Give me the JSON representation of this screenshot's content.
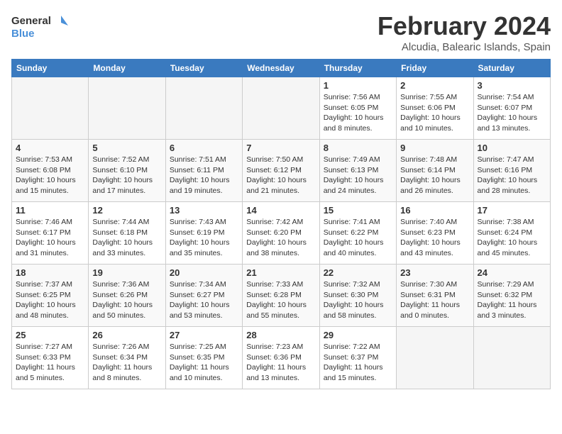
{
  "header": {
    "logo_general": "General",
    "logo_blue": "Blue",
    "month_title": "February 2024",
    "location": "Alcudia, Balearic Islands, Spain"
  },
  "days_of_week": [
    "Sunday",
    "Monday",
    "Tuesday",
    "Wednesday",
    "Thursday",
    "Friday",
    "Saturday"
  ],
  "weeks": [
    [
      {
        "day": "",
        "info": ""
      },
      {
        "day": "",
        "info": ""
      },
      {
        "day": "",
        "info": ""
      },
      {
        "day": "",
        "info": ""
      },
      {
        "day": "1",
        "info": "Sunrise: 7:56 AM\nSunset: 6:05 PM\nDaylight: 10 hours\nand 8 minutes."
      },
      {
        "day": "2",
        "info": "Sunrise: 7:55 AM\nSunset: 6:06 PM\nDaylight: 10 hours\nand 10 minutes."
      },
      {
        "day": "3",
        "info": "Sunrise: 7:54 AM\nSunset: 6:07 PM\nDaylight: 10 hours\nand 13 minutes."
      }
    ],
    [
      {
        "day": "4",
        "info": "Sunrise: 7:53 AM\nSunset: 6:08 PM\nDaylight: 10 hours\nand 15 minutes."
      },
      {
        "day": "5",
        "info": "Sunrise: 7:52 AM\nSunset: 6:10 PM\nDaylight: 10 hours\nand 17 minutes."
      },
      {
        "day": "6",
        "info": "Sunrise: 7:51 AM\nSunset: 6:11 PM\nDaylight: 10 hours\nand 19 minutes."
      },
      {
        "day": "7",
        "info": "Sunrise: 7:50 AM\nSunset: 6:12 PM\nDaylight: 10 hours\nand 21 minutes."
      },
      {
        "day": "8",
        "info": "Sunrise: 7:49 AM\nSunset: 6:13 PM\nDaylight: 10 hours\nand 24 minutes."
      },
      {
        "day": "9",
        "info": "Sunrise: 7:48 AM\nSunset: 6:14 PM\nDaylight: 10 hours\nand 26 minutes."
      },
      {
        "day": "10",
        "info": "Sunrise: 7:47 AM\nSunset: 6:16 PM\nDaylight: 10 hours\nand 28 minutes."
      }
    ],
    [
      {
        "day": "11",
        "info": "Sunrise: 7:46 AM\nSunset: 6:17 PM\nDaylight: 10 hours\nand 31 minutes."
      },
      {
        "day": "12",
        "info": "Sunrise: 7:44 AM\nSunset: 6:18 PM\nDaylight: 10 hours\nand 33 minutes."
      },
      {
        "day": "13",
        "info": "Sunrise: 7:43 AM\nSunset: 6:19 PM\nDaylight: 10 hours\nand 35 minutes."
      },
      {
        "day": "14",
        "info": "Sunrise: 7:42 AM\nSunset: 6:20 PM\nDaylight: 10 hours\nand 38 minutes."
      },
      {
        "day": "15",
        "info": "Sunrise: 7:41 AM\nSunset: 6:22 PM\nDaylight: 10 hours\nand 40 minutes."
      },
      {
        "day": "16",
        "info": "Sunrise: 7:40 AM\nSunset: 6:23 PM\nDaylight: 10 hours\nand 43 minutes."
      },
      {
        "day": "17",
        "info": "Sunrise: 7:38 AM\nSunset: 6:24 PM\nDaylight: 10 hours\nand 45 minutes."
      }
    ],
    [
      {
        "day": "18",
        "info": "Sunrise: 7:37 AM\nSunset: 6:25 PM\nDaylight: 10 hours\nand 48 minutes."
      },
      {
        "day": "19",
        "info": "Sunrise: 7:36 AM\nSunset: 6:26 PM\nDaylight: 10 hours\nand 50 minutes."
      },
      {
        "day": "20",
        "info": "Sunrise: 7:34 AM\nSunset: 6:27 PM\nDaylight: 10 hours\nand 53 minutes."
      },
      {
        "day": "21",
        "info": "Sunrise: 7:33 AM\nSunset: 6:28 PM\nDaylight: 10 hours\nand 55 minutes."
      },
      {
        "day": "22",
        "info": "Sunrise: 7:32 AM\nSunset: 6:30 PM\nDaylight: 10 hours\nand 58 minutes."
      },
      {
        "day": "23",
        "info": "Sunrise: 7:30 AM\nSunset: 6:31 PM\nDaylight: 11 hours\nand 0 minutes."
      },
      {
        "day": "24",
        "info": "Sunrise: 7:29 AM\nSunset: 6:32 PM\nDaylight: 11 hours\nand 3 minutes."
      }
    ],
    [
      {
        "day": "25",
        "info": "Sunrise: 7:27 AM\nSunset: 6:33 PM\nDaylight: 11 hours\nand 5 minutes."
      },
      {
        "day": "26",
        "info": "Sunrise: 7:26 AM\nSunset: 6:34 PM\nDaylight: 11 hours\nand 8 minutes."
      },
      {
        "day": "27",
        "info": "Sunrise: 7:25 AM\nSunset: 6:35 PM\nDaylight: 11 hours\nand 10 minutes."
      },
      {
        "day": "28",
        "info": "Sunrise: 7:23 AM\nSunset: 6:36 PM\nDaylight: 11 hours\nand 13 minutes."
      },
      {
        "day": "29",
        "info": "Sunrise: 7:22 AM\nSunset: 6:37 PM\nDaylight: 11 hours\nand 15 minutes."
      },
      {
        "day": "",
        "info": ""
      },
      {
        "day": "",
        "info": ""
      }
    ]
  ]
}
